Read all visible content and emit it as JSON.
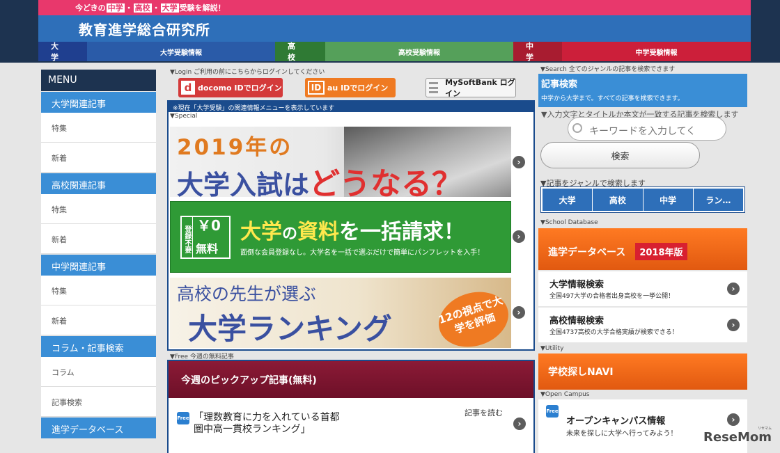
{
  "header": {
    "tagline_pre": "今どきの",
    "tagline_hl1": "中学",
    "tagline_sep1": "・",
    "tagline_hl2": "高校",
    "tagline_sep2": "・",
    "tagline_hl3": "大学",
    "tagline_post": "受験を解説！",
    "site_name": "教育進学総合研究所",
    "nav": [
      {
        "label": "大学",
        "tab": "大学受験情報",
        "label_color": "#1f3f8f",
        "tab_color": "#2a5ba8"
      },
      {
        "label": "高校",
        "tab": "高校受験情報",
        "label_color": "#2f7a34",
        "tab_color": "#55a05a"
      },
      {
        "label": "中学",
        "tab": "中学受験情報",
        "label_color": "#a81c30",
        "tab_color": "#cc1f3a"
      }
    ]
  },
  "menu": {
    "title": "MENU",
    "sections": [
      {
        "heading": "大学関連記事",
        "items": [
          "特集",
          "新着"
        ]
      },
      {
        "heading": "高校関連記事",
        "items": [
          "特集",
          "新着"
        ]
      },
      {
        "heading": "中学関連記事",
        "items": [
          "特集",
          "新着"
        ]
      },
      {
        "heading": "コラム・記事検索",
        "items": [
          "コラム",
          "記事検索"
        ]
      },
      {
        "heading": "進学データベース",
        "items": []
      }
    ]
  },
  "login": {
    "note": "▼Login ご利用の前にこちらからログインしてください",
    "docomo_icon": "d",
    "docomo": "docomo IDでログイン",
    "au_icon": "ID",
    "au": "au IDでログイン",
    "softbank": "MySoftBank ログイン"
  },
  "center": {
    "notice": "※現在「大学受験」の関連情報メニューを表示しています",
    "special_label": "▼Special",
    "banner1": {
      "line1": "2019年の",
      "line2a": "大学入試は",
      "line2b": "どうなる？"
    },
    "banner2": {
      "badge_v": "登録不要",
      "yen": "￥0",
      "free": "無料",
      "title_a": "大学",
      "title_b": "の",
      "title_c": "資料",
      "title_d": "を一括請求！",
      "sub": "面倒な会員登録なし。大学名を一括で選ぶだけで簡単にパンフレットを入手！"
    },
    "banner3": {
      "line1": "高校の先生が選ぶ",
      "line2": "大学ランキング",
      "badge": "12の視点で大学を評価"
    },
    "free_label": "▼Free 今週の無料記事",
    "pickup_head": "今週のピックアップ記事(無料)",
    "free_icon": "Free",
    "pick_title_1": "「理数教育に力を入れている首都",
    "pick_title_2": "圏中高一貫校ランキング」",
    "read_more": "記事を読む"
  },
  "right": {
    "search_label": "▼Search 全てのジャンルの記事を検索できます",
    "search_title": "記事検索",
    "search_sub": "中学から大学まで。すべての記事を検索できます。",
    "search_desc": "▼入力文字とタイトルか本文が一致する記事を検索します",
    "keyword_placeholder": "キーワードを入力してく",
    "search_button": "検索",
    "genre_label": "▼記事をジャンルで検索します",
    "genres": [
      "大学",
      "高校",
      "中学",
      "ラン…"
    ],
    "db_label": "▼School Database",
    "db_title": "進学データベース",
    "db_year": "2018年版",
    "db_items": [
      {
        "title": "大学情報検索",
        "sub": "全国497大学の合格者出身高校を一挙公開！"
      },
      {
        "title": "高校情報検索",
        "sub": "全国4737高校の大学合格実績が検索できる！"
      }
    ],
    "util_label": "▼Utility",
    "util_title": "学校探しNAVI",
    "oc_label": "▼Open Campus",
    "oc_icon": "Free",
    "oc_title": "オープンキャンパス情報",
    "oc_sub": "未来を探しに大学へ行ってみよう！"
  },
  "watermark": {
    "text": "ReseMom",
    "sub": "リセマム"
  },
  "icons": {
    "arrow": "›"
  }
}
